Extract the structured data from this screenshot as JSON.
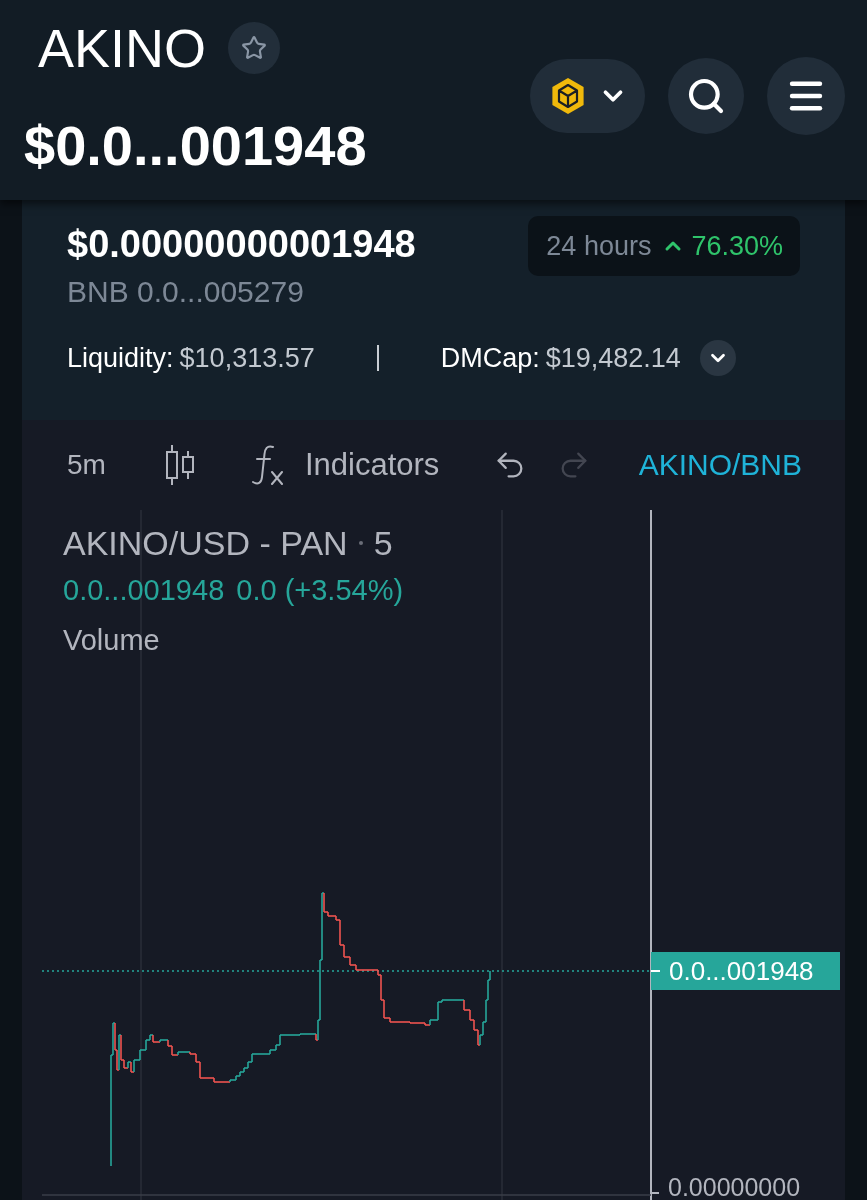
{
  "header": {
    "token_name": "AKINO",
    "favorite": false,
    "price": "$0.0...001948"
  },
  "price_card": {
    "price_usd": "$0.00000000001948",
    "price_bnb": "BNB 0.0...005279",
    "change": {
      "period": "24 hours",
      "rising": true,
      "value": "76.30%"
    },
    "stats": [
      {
        "label": "Liquidity:",
        "value": "$10,313.57"
      },
      {
        "label": "DMCap:",
        "value": "$19,482.14"
      }
    ],
    "expanded": false
  },
  "chart": {
    "toolbar": {
      "interval": "5m",
      "indicators": "Indicators",
      "undo": {
        "disabled": false
      },
      "redo": {
        "disabled": true
      },
      "pair_link": "AKINO/BNB"
    },
    "legend": {
      "title": "AKINO/USD - PAN",
      "interval": "5",
      "last_price": "0.0...001948",
      "change": "0.0 (+3.54%)",
      "volume": "Volume"
    },
    "price_axis": {
      "last_price": "0.0...001948",
      "bottom_label": "0.00000000"
    }
  }
}
